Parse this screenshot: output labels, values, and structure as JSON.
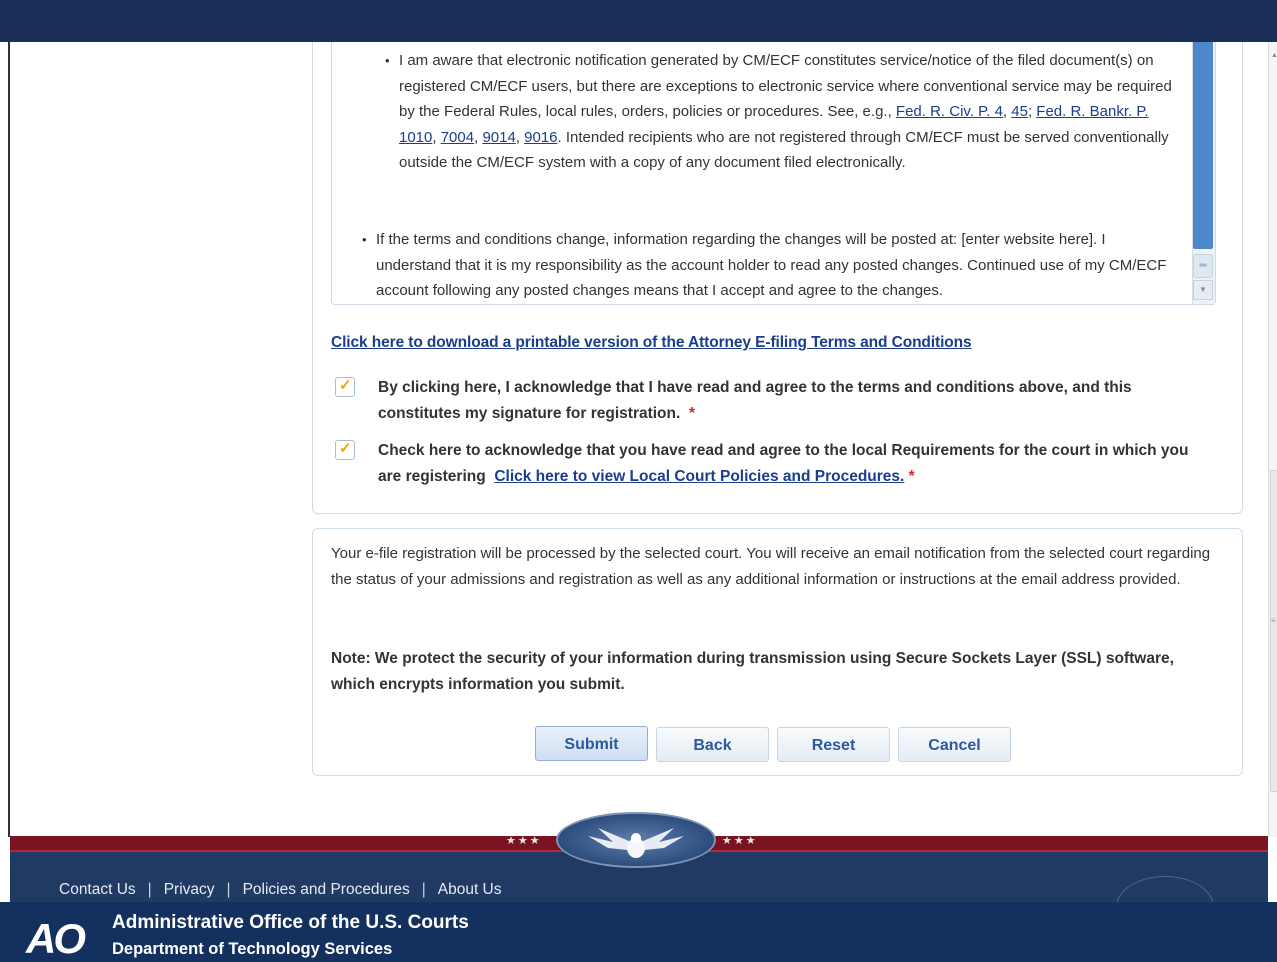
{
  "terms": {
    "bullet1_text1": "I am aware that electronic notification generated by CM/ECF constitutes service/notice of the filed document(s) on registered CM/ECF users, but there are exceptions to electronic service where conventional service may be required by the Federal Rules, local rules, orders, policies or procedures. See, e.g., ",
    "link_frcp": "Fed. R. Civ. P. 4",
    "link_45": "45",
    "link_frbp": "Fed. R. Bankr. P. 1010",
    "link_7004": "7004",
    "link_9014": "9014",
    "link_9016": "9016",
    "bullet1_text2": ". Intended recipients who are not registered through CM/ECF must be served conventionally outside the CM/ECF system with a copy of any document filed electronically.",
    "bullet2_text": "If the terms and conditions change, information regarding the changes will be posted at: [enter website here]. I understand that it is my responsibility as the account holder to read any posted changes. Continued use of my CM/ECF account following any posted changes means that I accept and agree to the changes."
  },
  "download_link": "Click here to download a printable version of the Attorney E-filing Terms and Conditions",
  "ack1": {
    "text": "By clicking here, I acknowledge that I have read and agree to the terms and conditions above, and this constitutes my signature for registration.",
    "required": "*",
    "checked": true
  },
  "ack2": {
    "text": "Check here to acknowledge that you have read and agree to the local Requirements for the court in which you are registering",
    "link": "Click here to view Local Court Policies and Procedures.",
    "required": "*",
    "checked": true
  },
  "info_text": "Your e-file registration will be processed by the selected court. You will receive an email notification from the selected court regarding the status of your admissions and registration as well as any additional information or instructions at the email address provided.",
  "note_text": "Note: We protect the security of your information during transmission using Secure Sockets Layer (SSL) software, which encrypts information you submit.",
  "buttons": {
    "submit": "Submit",
    "back": "Back",
    "reset": "Reset",
    "cancel": "Cancel"
  },
  "footer": {
    "links": [
      "Contact Us",
      "Privacy",
      "Policies and Procedures",
      "About Us"
    ],
    "separator": "|",
    "stars": "★★★",
    "logo": "AO",
    "org": "Administrative Office of the U.S. Courts",
    "dept": "Department of Technology Services"
  },
  "icons": {
    "check": "checkmark-icon",
    "scroll_down": "scroll-down-arrow-icon",
    "scroll_grip": "scroll-grip-icon",
    "eagle": "eagle-emblem-icon",
    "seal": "court-seal-icon"
  },
  "colors": {
    "header": "#1a2f5a",
    "link": "#1a3e8c",
    "required": "#d9232d",
    "check": "#f0a500",
    "footer_red": "#7a1420",
    "footer_blue": "#13305f"
  }
}
